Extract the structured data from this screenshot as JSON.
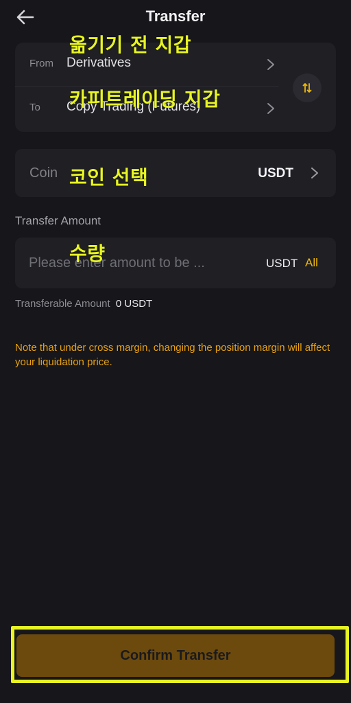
{
  "header": {
    "title": "Transfer",
    "back_icon": "arrow-left-icon"
  },
  "from_to": {
    "from_label": "From",
    "from_value": "Derivatives",
    "to_label": "To",
    "to_value": "Copy Trading (Futures)",
    "swap_icon": "swap-vertical-icon"
  },
  "coin": {
    "label": "Coin",
    "value": "USDT"
  },
  "amount": {
    "label": "Transfer Amount",
    "placeholder": "Please enter amount to be ...",
    "unit": "USDT",
    "all_label": "All"
  },
  "transferable": {
    "label": "Transferable Amount",
    "value": "0 USDT"
  },
  "note": "Note that under cross margin, changing the position margin will affect your liquidation price.",
  "confirm_label": "Confirm Transfer",
  "annotations": {
    "from_wallet": "옮기기 전 지갑",
    "copy_wallet": "카피트레이딩 지갑",
    "coin_select": "코인 선택",
    "quantity": "수량"
  },
  "colors": {
    "background": "#16161b",
    "card": "#1f1f24",
    "accent": "#f0b90b",
    "note": "#e8a213",
    "confirm_button": "#6c4a0d",
    "annotation": "#e8f522"
  }
}
